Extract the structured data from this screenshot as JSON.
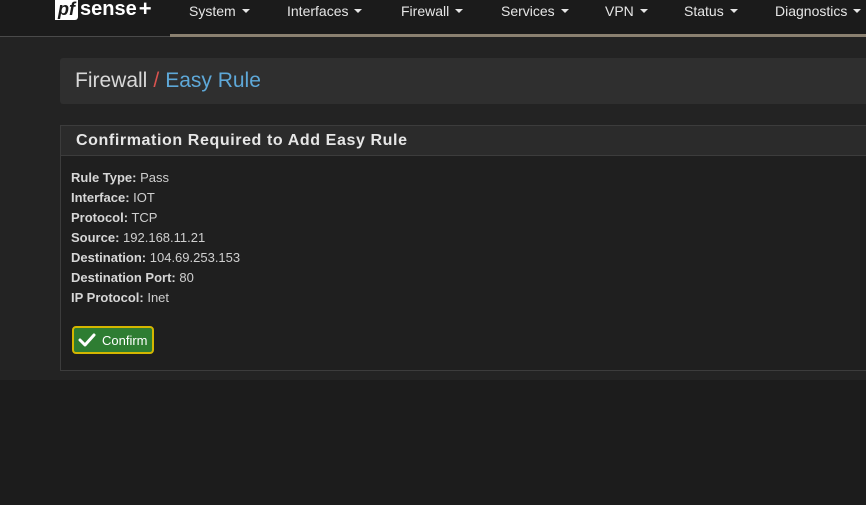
{
  "brand": {
    "pf": "pf",
    "sense": "sense",
    "plus": "+"
  },
  "nav": {
    "items": [
      {
        "label": "System"
      },
      {
        "label": "Interfaces"
      },
      {
        "label": "Firewall"
      },
      {
        "label": "Services"
      },
      {
        "label": "VPN"
      },
      {
        "label": "Status"
      },
      {
        "label": "Diagnostics"
      }
    ]
  },
  "breadcrumb": {
    "first": "Firewall",
    "separator": "/",
    "second": "Easy Rule"
  },
  "panel": {
    "title": "Confirmation Required to Add Easy Rule",
    "fields": [
      {
        "label": "Rule Type:",
        "value": "Pass"
      },
      {
        "label": "Interface:",
        "value": "IOT"
      },
      {
        "label": "Protocol:",
        "value": "TCP"
      },
      {
        "label": "Source:",
        "value": "192.168.11.21"
      },
      {
        "label": "Destination:",
        "value": "104.69.253.153"
      },
      {
        "label": "Destination Port:",
        "value": "80"
      },
      {
        "label": "IP Protocol:",
        "value": "Inet"
      }
    ],
    "confirm_label": "Confirm"
  },
  "colors": {
    "accent_red": "#d9534f",
    "accent_blue": "#5ea8d8",
    "button_green": "#2e7d32"
  }
}
